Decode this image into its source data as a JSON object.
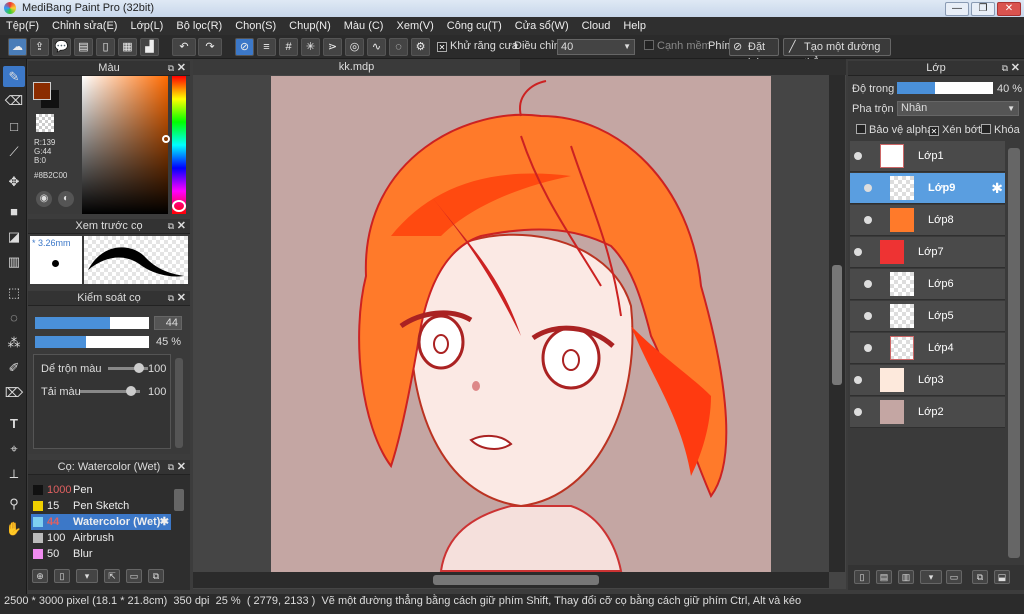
{
  "window": {
    "title": "MediBang Paint Pro (32bit)",
    "min": "—",
    "max": "❐",
    "close": "✕"
  },
  "menu": [
    "Tệp(F)",
    "Chỉnh sửa(E)",
    "Lớp(L)",
    "Bộ lọc(R)",
    "Chọn(S)",
    "Chụp(N)",
    "Màu (C)",
    "Xem(V)",
    "Công cụ(T)",
    "Cửa sổ(W)",
    "Cloud",
    "Help"
  ],
  "toolbar": {
    "antialias": "Khử răng cưa",
    "adjust_label": "Điều chỉnh",
    "adjust_value": "40",
    "smooth": "Cạnh mềm",
    "key_label": "Phím",
    "reset": "Đặt lại",
    "straight": "Tạo một đường thẳng"
  },
  "color_panel": {
    "title": "Màu",
    "r": "R:139",
    "g": "G:44",
    "b": "B:0",
    "hex": "#8B2C00",
    "current_color": "#8B2C00"
  },
  "brush_preview": {
    "title": "Xem trước cọ",
    "size": "* 3.26mm"
  },
  "brush_control": {
    "title": "Kiểm soát cọ",
    "size_value": "44",
    "opacity_value": "45 %",
    "size_fill": 0.66,
    "opacity_fill": 0.45,
    "mix_label": "Dể trộn màu",
    "mix_value": "100",
    "amount_label": "Tải màu",
    "amount_value": "100"
  },
  "brush_list": {
    "title": "Cọ: Watercolor (Wet)",
    "items": [
      {
        "num": "1000",
        "name": "Pen",
        "color": "#111111"
      },
      {
        "num": "15",
        "name": "Pen Sketch",
        "color": "#f0d000"
      },
      {
        "num": "44",
        "name": "Watercolor (Wet)",
        "color": "#7fd0f0",
        "selected": true
      },
      {
        "num": "100",
        "name": "Airbrush",
        "color": "#bbbbbb"
      },
      {
        "num": "50",
        "name": "Blur",
        "color": "#f08cf0"
      }
    ]
  },
  "document": {
    "tab": "kk.mdp"
  },
  "layer_panel": {
    "title": "Lớp",
    "opacity_label": "Độ trong",
    "opacity_value": "40 %",
    "opacity_fill": 0.4,
    "blend_label": "Pha trộn",
    "blend_value": "Nhân",
    "protect_alpha": "Bảo vệ alpha",
    "clip": "Xén bớt",
    "lock": "Khóa",
    "layers": [
      {
        "name": "Lớp1"
      },
      {
        "name": "Lớp9",
        "selected": true
      },
      {
        "name": "Lớp8"
      },
      {
        "name": "Lớp7"
      },
      {
        "name": "Lớp6"
      },
      {
        "name": "Lớp5"
      },
      {
        "name": "Lớp4"
      },
      {
        "name": "Lớp3"
      },
      {
        "name": "Lớp2"
      }
    ]
  },
  "status": {
    "size": "2500 * 3000 pixel",
    "cm": "(18.1 * 21.8cm)",
    "dpi": "350 dpi",
    "zoom": "25 %",
    "coords": "( 2779, 2133 )",
    "hint": "Vẽ một đường thẳng bằng cách giữ phím Shift, Thay đổi cỡ cọ bằng cách giữ phím Ctrl, Alt và kéo"
  }
}
